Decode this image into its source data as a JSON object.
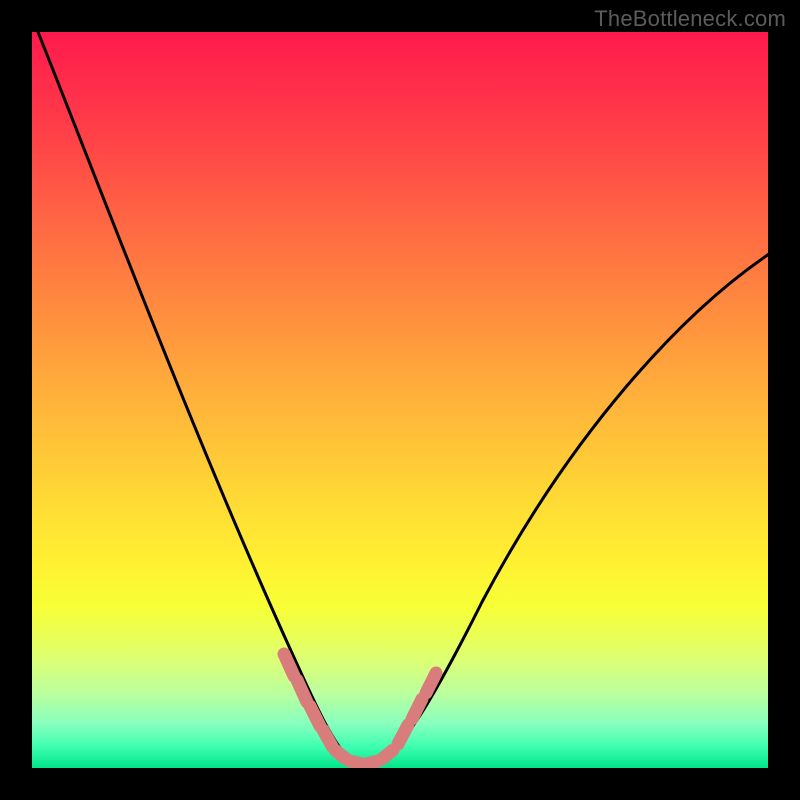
{
  "watermark": "TheBottleneck.com",
  "colors": {
    "background": "#000000",
    "gradient_top": "#ff1a4d",
    "gradient_mid": "#fff032",
    "gradient_bottom": "#00e58a",
    "curve": "#000000",
    "marker": "#d97c7c"
  },
  "chart_data": {
    "type": "line",
    "title": "",
    "xlabel": "",
    "ylabel": "",
    "xlim": [
      0,
      100
    ],
    "ylim": [
      0,
      100
    ],
    "series": [
      {
        "name": "left-curve",
        "x": [
          0,
          5,
          10,
          15,
          20,
          25,
          30,
          33,
          36,
          38,
          40,
          42
        ],
        "y": [
          100,
          85,
          71,
          58,
          45,
          33,
          22,
          15,
          9,
          5,
          2,
          0
        ]
      },
      {
        "name": "right-curve",
        "x": [
          48,
          50,
          52,
          55,
          60,
          65,
          70,
          75,
          80,
          85,
          90,
          95,
          100
        ],
        "y": [
          0,
          2,
          5,
          10,
          18,
          26,
          34,
          41,
          48,
          54,
          60,
          65,
          70
        ]
      }
    ],
    "markers": [
      {
        "name": "left-dash-1",
        "x": 35.5,
        "y": 12
      },
      {
        "name": "left-dash-2",
        "x": 37.0,
        "y": 9
      },
      {
        "name": "left-dash-3",
        "x": 38.5,
        "y": 6
      },
      {
        "name": "left-dash-4",
        "x": 40.0,
        "y": 3.5
      },
      {
        "name": "bottom-1",
        "x": 42.0,
        "y": 1.2
      },
      {
        "name": "bottom-2",
        "x": 44.0,
        "y": 0.6
      },
      {
        "name": "bottom-3",
        "x": 46.0,
        "y": 0.6
      },
      {
        "name": "bottom-4",
        "x": 48.0,
        "y": 1.2
      },
      {
        "name": "right-dash-1",
        "x": 50.5,
        "y": 4.5
      },
      {
        "name": "right-dash-2",
        "x": 52.0,
        "y": 8
      },
      {
        "name": "right-dash-3",
        "x": 53.5,
        "y": 11.5
      }
    ],
    "annotations": []
  }
}
